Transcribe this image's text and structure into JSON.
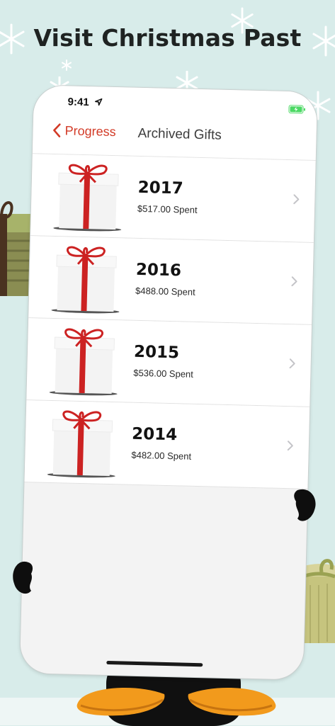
{
  "headline": "Visit Christmas Past",
  "status_bar": {
    "time": "9:41"
  },
  "nav": {
    "back_label": "Progress",
    "title": "Archived Gifts"
  },
  "gifts": [
    {
      "year": "2017",
      "spent": "$517.00 Spent"
    },
    {
      "year": "2016",
      "spent": "$488.00 Spent"
    },
    {
      "year": "2015",
      "spent": "$536.00 Spent"
    },
    {
      "year": "2014",
      "spent": "$482.00 Spent"
    }
  ],
  "icons": {
    "back": "chevron-left-icon",
    "row_disclosure": "chevron-right-icon",
    "location": "location-arrow-icon",
    "battery": "battery-charging-icon",
    "decoration": "snowflake-icon"
  },
  "colors": {
    "accent": "#d23a26",
    "ribbon": "#cc2222",
    "background": "#d8ecea",
    "battery": "#4cd964"
  }
}
